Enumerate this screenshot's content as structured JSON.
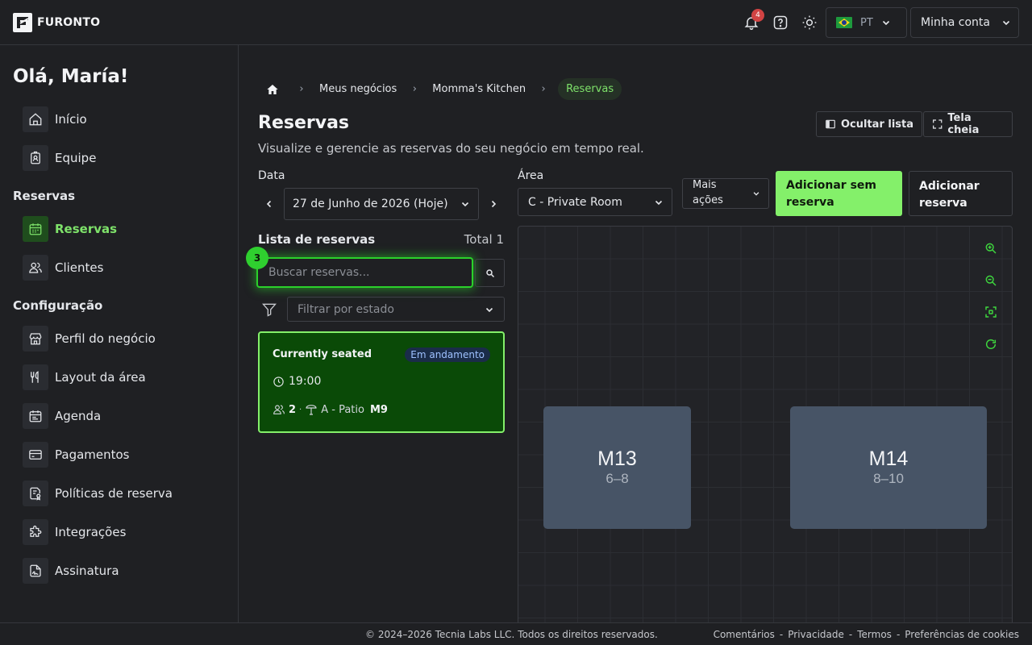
{
  "brand": {
    "name": "FURONTO"
  },
  "topbar": {
    "notification_count": "4",
    "language": "PT",
    "account_label": "Minha conta"
  },
  "sidebar": {
    "greeting": "Olá, María!",
    "items_main": [
      {
        "label": "Início",
        "icon": "home-icon"
      },
      {
        "label": "Equipe",
        "icon": "badge-icon"
      }
    ],
    "section_reservas": "Reservas",
    "items_reservas": [
      {
        "label": "Reservas",
        "icon": "calendar-icon",
        "active": true
      },
      {
        "label": "Clientes",
        "icon": "users-icon"
      }
    ],
    "section_config": "Configuração",
    "items_config": [
      {
        "label": "Perfil do negócio",
        "icon": "store-icon"
      },
      {
        "label": "Layout da área",
        "icon": "utensils-icon"
      },
      {
        "label": "Agenda",
        "icon": "agenda-icon"
      },
      {
        "label": "Pagamentos",
        "icon": "credit-card-icon"
      },
      {
        "label": "Políticas de reserva",
        "icon": "policy-icon"
      },
      {
        "label": "Integrações",
        "icon": "puzzle-icon"
      },
      {
        "label": "Assinatura",
        "icon": "signature-icon"
      }
    ]
  },
  "breadcrumb": {
    "items": [
      "Meus negócios",
      "Momma's Kitchen"
    ],
    "current": "Reservas"
  },
  "page": {
    "title": "Reservas",
    "subtitle": "Visualize e gerencie as reservas do seu negócio em tempo real.",
    "hide_list_label": "Ocultar lista",
    "fullscreen_label": "Tela cheia"
  },
  "controls": {
    "date_label": "Data",
    "date_value": "27 de Junho de 2026 (Hoje)",
    "area_label": "Área",
    "area_value": "C - Private Room",
    "more_actions_line1": "Mais",
    "more_actions_line2": "ações",
    "add_walkin_line1": "Adicionar sem",
    "add_walkin_line2": "reserva",
    "add_res_line1": "Adicionar",
    "add_res_line2": "reserva"
  },
  "list": {
    "title": "Lista de reservas",
    "total": "Total 1",
    "search_placeholder": "Buscar reservas...",
    "filter_placeholder": "Filtrar por estado",
    "step_badge": "3",
    "reservations": [
      {
        "name": "Currently seated",
        "status": "Em andamento",
        "time": "19:00",
        "party": "2",
        "separator": "·",
        "area": "A - Patio",
        "table": "M9"
      }
    ]
  },
  "floor": {
    "tables": [
      {
        "name": "M13",
        "capacity": "6–8"
      },
      {
        "name": "M14",
        "capacity": "8–10"
      }
    ]
  },
  "footer": {
    "copyright": "© 2024–2026 Tecnia Labs LLC. Todos os direitos reservados.",
    "links": [
      "Comentários",
      "-",
      "Privacidade",
      "-",
      "Termos",
      "-",
      "Preferências de cookies"
    ]
  },
  "colors": {
    "accent_green": "#84f06a",
    "card_green": "#0a4a07",
    "status_badge_bg": "#1a2c49",
    "table_fill": "#475466",
    "notification_red": "#d14343"
  }
}
